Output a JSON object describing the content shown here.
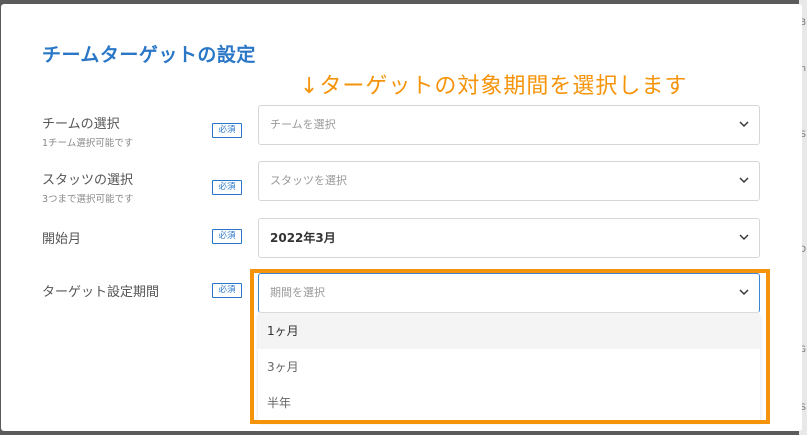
{
  "dialog": {
    "title": "チームターゲットの設定",
    "annotation": "↓ターゲットの対象期間を選択します",
    "required_badge": "必須"
  },
  "fields": [
    {
      "label": "チームの選択",
      "sub": "1チーム選択可能です",
      "placeholder": "チームを選択"
    },
    {
      "label": "スタッツの選択",
      "sub": "3つまで選択可能です",
      "placeholder": "スタッツを選択"
    },
    {
      "label": "開始月",
      "value": "2022年3月"
    },
    {
      "label": "ターゲット設定期間",
      "placeholder": "期間を選択",
      "options": [
        "1ヶ月",
        "3ヶ月",
        "半年"
      ],
      "highlighted": "1ヶ月"
    }
  ],
  "background_marks": [
    "B",
    "n",
    "S",
    "D",
    "G",
    "S"
  ],
  "colors": {
    "accent": "#2a77c7",
    "annotation": "#f5940a",
    "highlight_border": "#f5940a"
  },
  "icons": {
    "dropdown": "chevron-down-icon"
  }
}
